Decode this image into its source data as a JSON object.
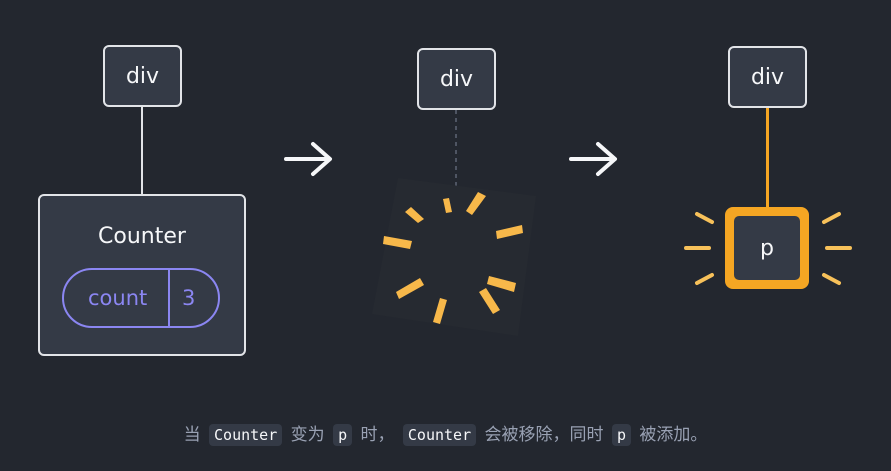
{
  "diagram": {
    "left": {
      "parent_label": "div",
      "child_label": "Counter",
      "state_key": "count",
      "state_value": "3"
    },
    "middle": {
      "parent_label": "div"
    },
    "right": {
      "parent_label": "div",
      "child_label": "p"
    }
  },
  "caption": {
    "part1": "当",
    "code1": "Counter",
    "part2": "变为",
    "code2": "p",
    "part3": "时，",
    "code3": "Counter",
    "part4": "会被移除，同时",
    "code4": "p",
    "part5": "被添加。"
  },
  "colors": {
    "background": "#23272f",
    "node_fill": "#343a46",
    "node_border": "#e2e4e8",
    "state_purple": "#8b86f2",
    "accent_orange": "#f5a623",
    "burst_yellow": "#f7c15a"
  }
}
